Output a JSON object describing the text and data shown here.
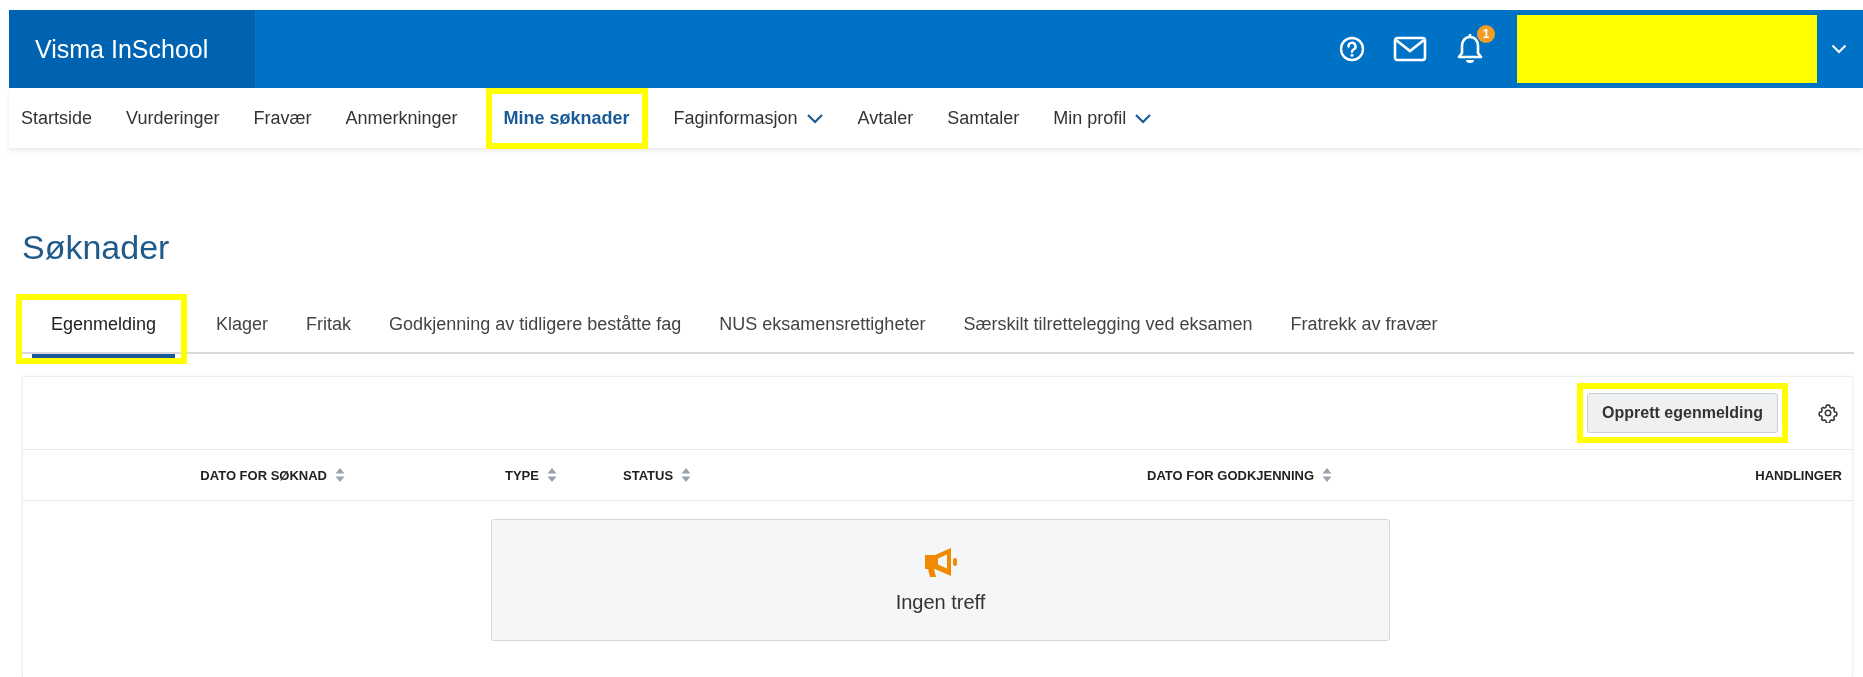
{
  "app": {
    "title": "Visma InSchool",
    "notification_count": "1"
  },
  "nav": [
    {
      "label": "Startside",
      "selected": false,
      "highlighted": false,
      "dropdown": false
    },
    {
      "label": "Vurderinger",
      "selected": false,
      "highlighted": false,
      "dropdown": false
    },
    {
      "label": "Fravær",
      "selected": false,
      "highlighted": false,
      "dropdown": false
    },
    {
      "label": "Anmerkninger",
      "selected": false,
      "highlighted": false,
      "dropdown": false
    },
    {
      "label": "Mine søknader",
      "selected": true,
      "highlighted": true,
      "dropdown": false
    },
    {
      "label": "Faginformasjon",
      "selected": false,
      "highlighted": false,
      "dropdown": true
    },
    {
      "label": "Avtaler",
      "selected": false,
      "highlighted": false,
      "dropdown": false
    },
    {
      "label": "Samtaler",
      "selected": false,
      "highlighted": false,
      "dropdown": false
    },
    {
      "label": "Min profil",
      "selected": false,
      "highlighted": false,
      "dropdown": true
    }
  ],
  "page_title": "Søknader",
  "tabs": [
    {
      "label": "Egenmelding",
      "selected": true,
      "highlighted": true
    },
    {
      "label": "Klager",
      "selected": false,
      "highlighted": false
    },
    {
      "label": "Fritak",
      "selected": false,
      "highlighted": false
    },
    {
      "label": "Godkjenning av tidligere beståtte fag",
      "selected": false,
      "highlighted": false
    },
    {
      "label": "NUS eksamensrettigheter",
      "selected": false,
      "highlighted": false
    },
    {
      "label": "Særskilt tilrettelegging ved eksamen",
      "selected": false,
      "highlighted": false
    },
    {
      "label": "Fratrekk av fravær",
      "selected": false,
      "highlighted": false
    }
  ],
  "toolbar": {
    "button": {
      "label": "Opprett egenmelding",
      "highlighted": true
    }
  },
  "table": {
    "columns": [
      {
        "label": "DATO FOR SØKNAD",
        "sortable": true
      },
      {
        "label": "TYPE",
        "sortable": true
      },
      {
        "label": "STATUS",
        "sortable": true
      },
      {
        "label": "DATO FOR GODKJENNING",
        "sortable": true
      },
      {
        "label": "HANDLINGER",
        "sortable": false
      }
    ],
    "empty_message": "Ingen treff"
  }
}
